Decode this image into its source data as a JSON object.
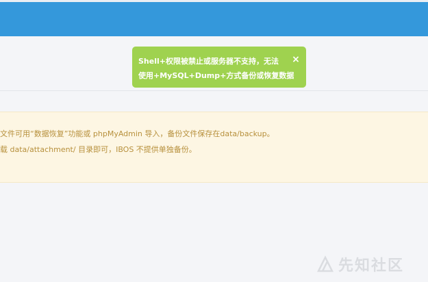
{
  "toast": {
    "line1": "Shell+权限被禁止或服务器不支持，无法",
    "line2": "使用+MySQL+Dump+方式备份或恢复数据",
    "close_symbol": "×"
  },
  "notice": {
    "line1": "文件可用“数据恢复”功能或 phpMyAdmin 导入，备份文件保存在data/backup。",
    "line2": "载 data/attachment/ 目录即可，IBOS 不提供单独备份。"
  },
  "watermark": {
    "text": "先知社区",
    "icon": "xianzhi-logo-icon"
  },
  "colors": {
    "topbar": "#3498db",
    "toast_bg": "#9fd24f",
    "notice_bg": "#fdf6e3",
    "notice_text": "#b7903c"
  }
}
